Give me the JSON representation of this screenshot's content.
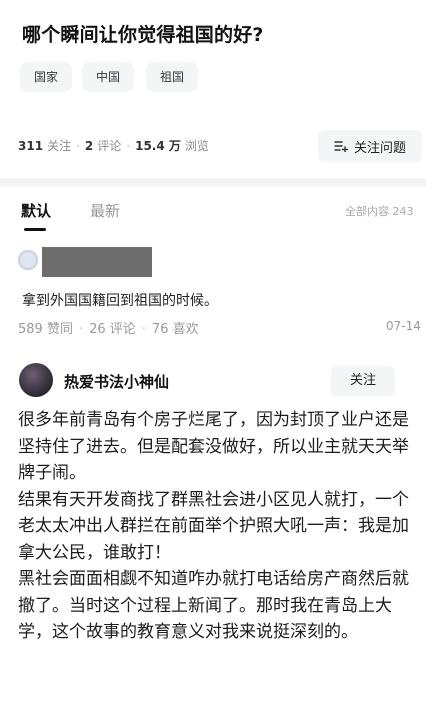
{
  "question": {
    "title": "哪个瞬间让你觉得祖国的好?",
    "tags": [
      "国家",
      "中国",
      "祖国"
    ],
    "stats": {
      "followers_count": "311",
      "followers_label": "关注",
      "comments_count": "2",
      "comments_label": "评论",
      "views_count": "15.4 万",
      "views_label": "浏览"
    },
    "follow_button": "关注问题"
  },
  "tabs": {
    "default": "默认",
    "latest": "最新",
    "all_count": "全部内容 243"
  },
  "answers": [
    {
      "text": "拿到外国国籍回到祖国的时候。",
      "likes": "589 赞同",
      "comments": "26 评论",
      "favorites": "76 喜欢",
      "date": "07-14"
    },
    {
      "author": "热爱书法小神仙",
      "follow_label": "关注",
      "paragraphs": [
        "很多年前青岛有个房子烂尾了，因为封顶了业户还是坚持住了进去。但是配套没做好，所以业主就天天举牌子闹。",
        "结果有天开发商找了群黑社会进小区见人就打，一个老太太冲出人群拦在前面举个护照大吼一声：我是加拿大公民，谁敢打！",
        "黑社会面面相觑不知道咋办就打电话给房产商然后就撤了。当时这个过程上新闻了。那时我在青岛上大学，这个故事的教育意义对我来说挺深刻的。"
      ]
    }
  ],
  "colors": {
    "text": "#1a1a1a",
    "muted": "#8c8c8c",
    "chip_bg": "#f4f5f7",
    "divider": "#f3f4f6"
  }
}
